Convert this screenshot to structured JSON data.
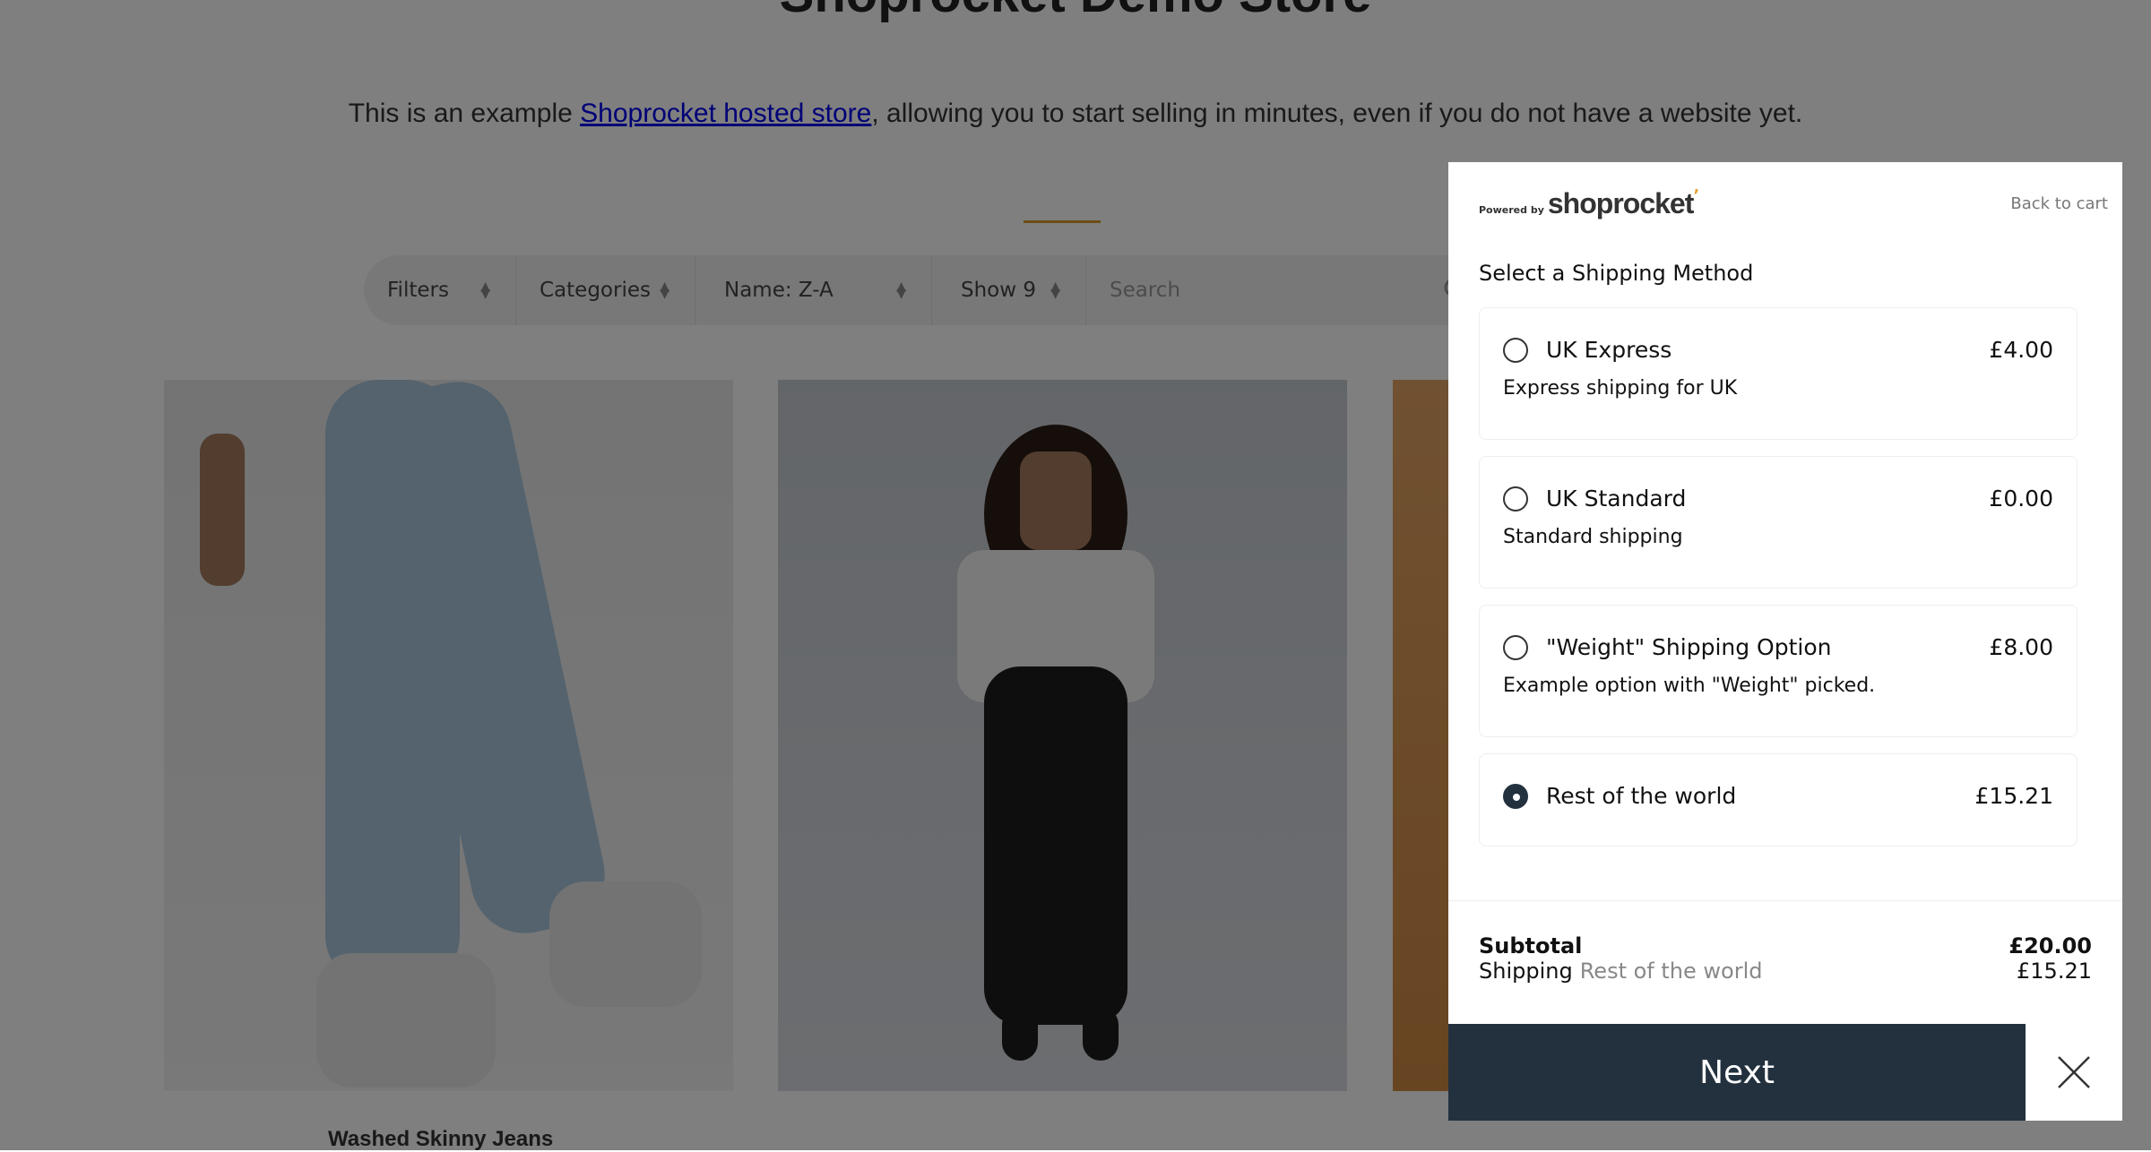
{
  "store": {
    "title": "Shoprocket Demo Store",
    "intro_before": "This is an example ",
    "intro_link": "Shoprocket hosted store",
    "intro_after": ", allowing you to start selling in minutes, even if you do not have a website yet.",
    "filters": {
      "filters_label": "Filters",
      "categories_label": "Categories",
      "sort_label": "Name: Z-A",
      "show_label": "Show 9",
      "search_placeholder": "Search"
    },
    "products": [
      {
        "name": "Washed Skinny Jeans"
      }
    ]
  },
  "panel": {
    "powered_by": "Powered by",
    "brand": "shoprocket",
    "back_link": "Back to cart",
    "section_title": "Select a Shipping Method",
    "options": [
      {
        "name": "UK Express",
        "price": "£4.00",
        "description": "Express shipping for UK",
        "selected": false
      },
      {
        "name": "UK Standard",
        "price": "£0.00",
        "description": "Standard shipping",
        "selected": false
      },
      {
        "name": "\"Weight\" Shipping Option",
        "price": "£8.00",
        "description": "Example option with \"Weight\" picked.",
        "selected": false
      },
      {
        "name": "Rest of the world",
        "price": "£15.21",
        "selected": true
      }
    ],
    "subtotal_label": "Subtotal",
    "subtotal_value": "£20.00",
    "shipping_label": "Shipping",
    "shipping_method": "Rest of the world",
    "shipping_value": "£15.21",
    "next_label": "Next"
  },
  "colors": {
    "accent": "#23313f",
    "brand_tick": "#e8a033",
    "link": "#0000ee"
  }
}
